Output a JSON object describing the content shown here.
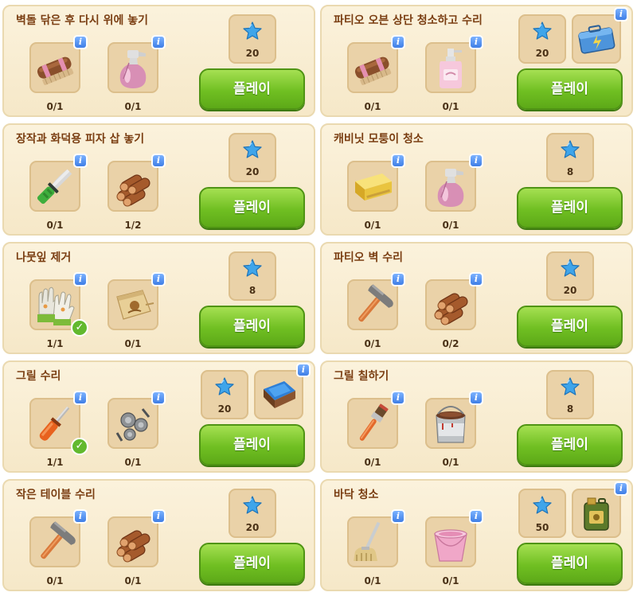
{
  "quests": [
    {
      "title": "벽돌 닦은 후 다시 위에 놓기",
      "items": [
        {
          "icon": "brush-icon",
          "count": "0/1",
          "done": false
        },
        {
          "icon": "spray-bottle-icon",
          "count": "0/1",
          "done": false
        }
      ],
      "reward": "20",
      "bonus": null,
      "play": "플레이"
    },
    {
      "title": "파티오 오븐 상단 청소하고 수리",
      "items": [
        {
          "icon": "brush-icon",
          "count": "0/1",
          "done": false
        },
        {
          "icon": "soap-bottle-icon",
          "count": "0/1",
          "done": false
        }
      ],
      "reward": "20",
      "bonus": "energy-case-icon",
      "play": "플레이"
    },
    {
      "title": "장작과 화덕용 피자 삽 놓기",
      "items": [
        {
          "icon": "knife-icon",
          "count": "0/1",
          "done": false
        },
        {
          "icon": "log-pile-icon",
          "count": "1/2",
          "done": false
        }
      ],
      "reward": "20",
      "bonus": null,
      "play": "플레이"
    },
    {
      "title": "캐비닛 모퉁이 청소",
      "items": [
        {
          "icon": "sponge-icon",
          "count": "0/1",
          "done": false
        },
        {
          "icon": "spray-bottle-icon",
          "count": "0/1",
          "done": false
        }
      ],
      "reward": "8",
      "bonus": null,
      "play": "플레이"
    },
    {
      "title": "나뭇잎 제거",
      "items": [
        {
          "icon": "gloves-icon",
          "count": "1/1",
          "done": true
        },
        {
          "icon": "seed-bag-icon",
          "count": "0/1",
          "done": false
        }
      ],
      "reward": "8",
      "bonus": null,
      "play": "플레이"
    },
    {
      "title": "파티오 벽 수리",
      "items": [
        {
          "icon": "hammer-icon",
          "count": "0/1",
          "done": false
        },
        {
          "icon": "log-pile-icon",
          "count": "0/2",
          "done": false
        }
      ],
      "reward": "20",
      "bonus": null,
      "play": "플레이"
    },
    {
      "title": "그릴 수리",
      "items": [
        {
          "icon": "screwdriver-icon",
          "count": "1/1",
          "done": true
        },
        {
          "icon": "bolts-icon",
          "count": "0/1",
          "done": false
        }
      ],
      "reward": "20",
      "bonus": "paint-tray-icon",
      "play": "플레이"
    },
    {
      "title": "그릴 칠하기",
      "items": [
        {
          "icon": "paintbrush-icon",
          "count": "0/1",
          "done": false
        },
        {
          "icon": "paint-can-icon",
          "count": "0/1",
          "done": false
        }
      ],
      "reward": "8",
      "bonus": null,
      "play": "플레이"
    },
    {
      "title": "작은 테이블 수리",
      "items": [
        {
          "icon": "hammer-icon",
          "count": "0/1",
          "done": false
        },
        {
          "icon": "log-pile-icon",
          "count": "0/1",
          "done": false
        }
      ],
      "reward": "20",
      "bonus": null,
      "play": "플레이"
    },
    {
      "title": "바닥 청소",
      "items": [
        {
          "icon": "mop-icon",
          "count": "0/1",
          "done": false
        },
        {
          "icon": "bucket-icon",
          "count": "0/1",
          "done": false
        }
      ],
      "reward": "50",
      "bonus": "jerrycan-icon",
      "play": "플레이"
    }
  ],
  "colors": {
    "title": "#7a3e12",
    "play_button": "#70bf22",
    "star": "#3fa5ea",
    "info_badge": "#3f7ee6",
    "check": "#62b92e"
  }
}
